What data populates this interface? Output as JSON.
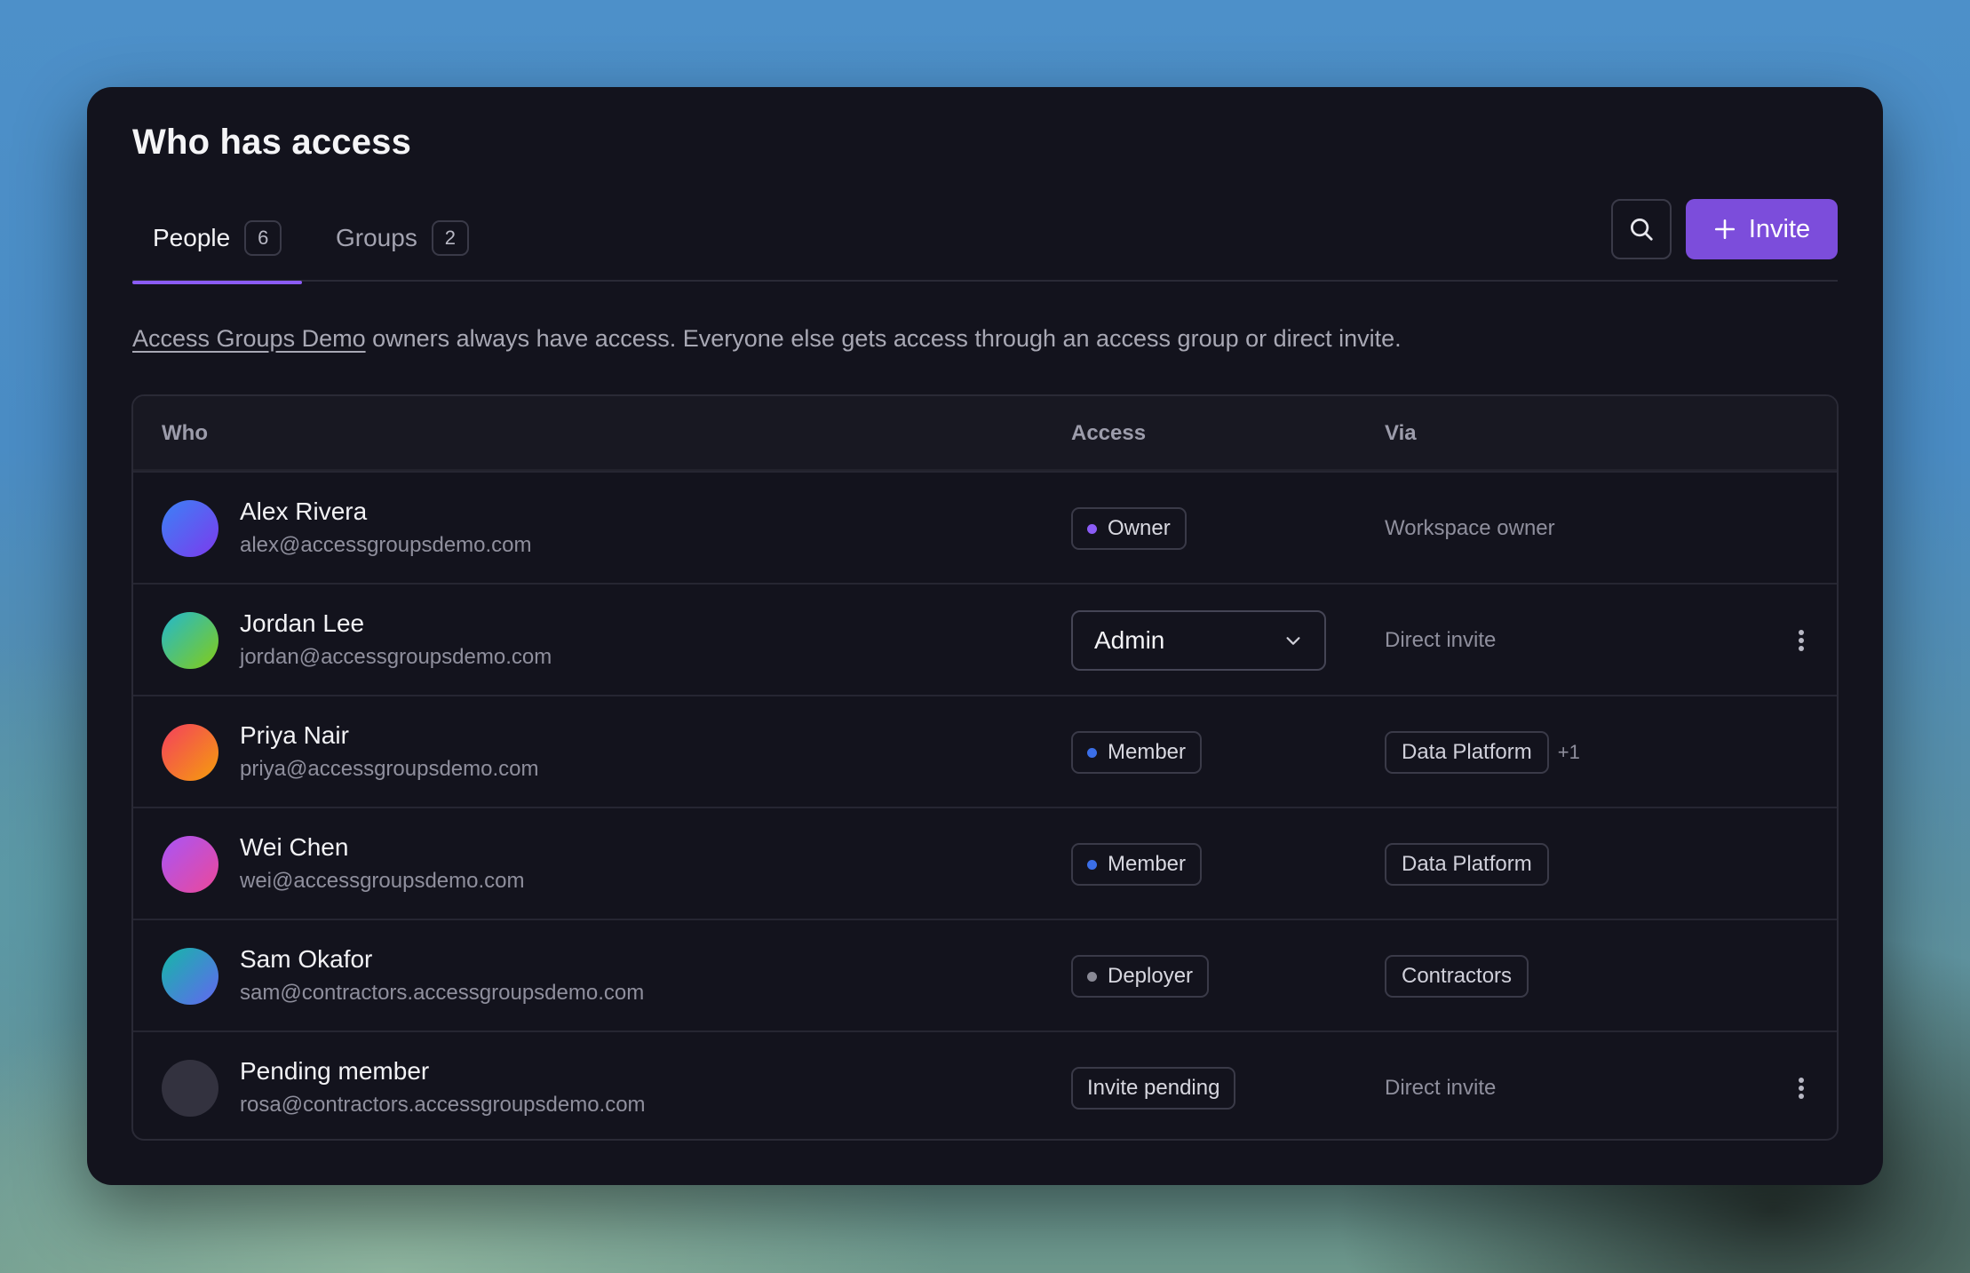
{
  "page": {
    "title": "Who has access"
  },
  "tabs": [
    {
      "label": "People",
      "count": "6"
    },
    {
      "label": "Groups",
      "count": "2"
    }
  ],
  "toolbar": {
    "search_icon": "search-icon",
    "invite_label": "Invite",
    "invite_icon": "plus-icon"
  },
  "description": {
    "link_text": "Access Groups Demo",
    "text": " owners always have access. Everyone else gets access through an access group or direct invite."
  },
  "table": {
    "headers": {
      "who": "Who",
      "access": "Access",
      "via": "Via"
    },
    "rows": [
      {
        "name": "Alex Rivera",
        "email": "alex@accessgroupsdemo.com",
        "access": "Owner",
        "via": "Workspace owner"
      },
      {
        "name": "Jordan Lee",
        "email": "jordan@accessgroupsdemo.com",
        "access": "Admin",
        "via": "Direct invite"
      },
      {
        "name": "Priya Nair",
        "email": "priya@accessgroupsdemo.com",
        "access": "Member",
        "via": "Data Platform",
        "via_extra": "+1"
      },
      {
        "name": "Wei Chen",
        "email": "wei@accessgroupsdemo.com",
        "access": "Member",
        "via": "Data Platform"
      },
      {
        "name": "Sam Okafor",
        "email": "sam@contractors.accessgroupsdemo.com",
        "access": "Deployer",
        "via": "Contractors"
      },
      {
        "name": "Pending member",
        "email": "rosa@contractors.accessgroupsdemo.com",
        "access": "Invite pending",
        "via": "Direct invite"
      }
    ]
  },
  "colors": {
    "accent": "#7c4ddb",
    "tab_underline": "#8b5cf6",
    "owner_dot": "#8b5cf6",
    "member_dot": "#3b6fe8",
    "deployer_dot": "#8a8a96"
  }
}
